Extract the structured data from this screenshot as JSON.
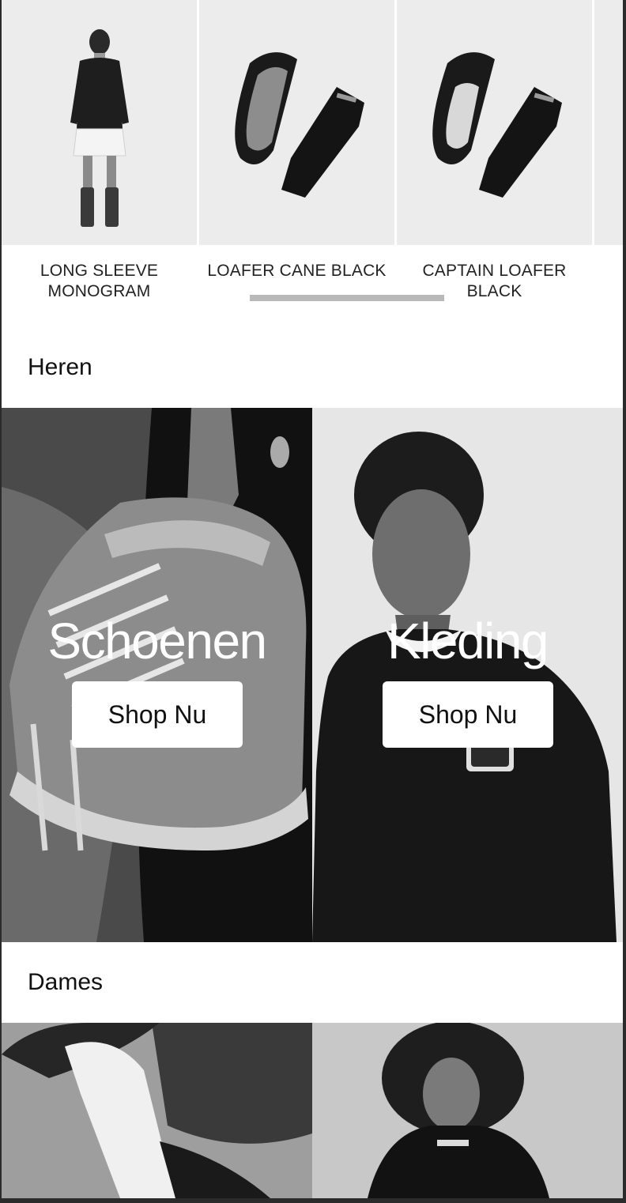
{
  "products": [
    {
      "name": "LONG SLEEVE MONOGRAM",
      "image_icon": "model-photo"
    },
    {
      "name": "LOAFER CANE BLACK",
      "image_icon": "loafer-photo"
    },
    {
      "name": "CAPTAIN LOAFER BLACK",
      "image_icon": "loafer-photo"
    }
  ],
  "sections": {
    "men": {
      "title": "Heren",
      "tiles": [
        {
          "title": "Schoenen",
          "button": "Shop Nu"
        },
        {
          "title": "Kleding",
          "button": "Shop Nu"
        }
      ]
    },
    "women": {
      "title": "Dames"
    }
  },
  "colors": {
    "page_background": "#ffffff",
    "product_background": "#ececec",
    "text": "#111111",
    "button_background": "#ffffff"
  }
}
